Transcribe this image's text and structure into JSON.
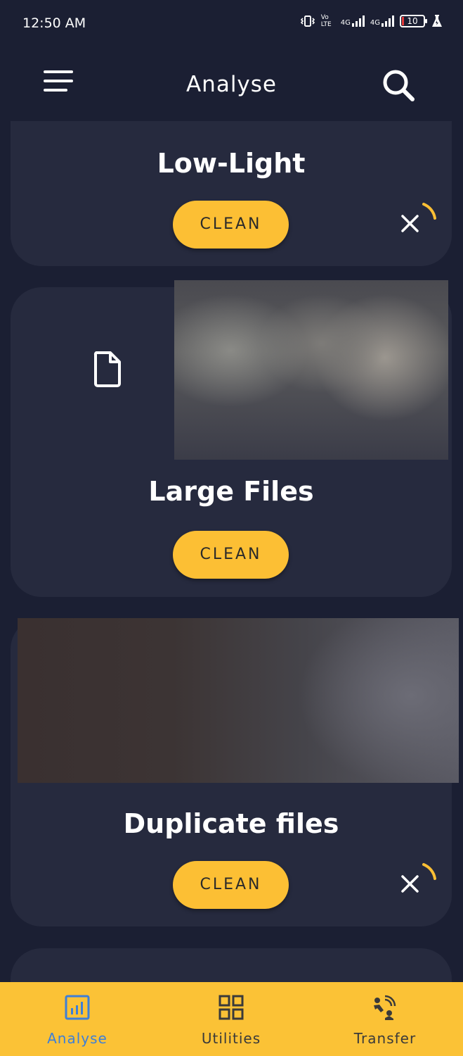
{
  "status_bar": {
    "time": "12:50 AM",
    "volte": "Vo LTE",
    "net1": "4G",
    "net2": "4G",
    "battery": "10",
    "icons": [
      "vibrate-icon",
      "volte-icon",
      "signal-icon",
      "signal-icon",
      "battery-icon",
      "battery-saver-icon"
    ]
  },
  "app_bar": {
    "title": "Analyse",
    "menu_icon": "hamburger-menu-icon",
    "search_icon": "search-icon"
  },
  "cards": [
    {
      "title": "Low-Light",
      "button": "CLEAN"
    },
    {
      "title": "Large Files",
      "button": "CLEAN",
      "icon": "file-icon"
    },
    {
      "title": "Duplicate files",
      "button": "CLEAN"
    }
  ],
  "bottom_nav": {
    "items": [
      {
        "label": "Analyse",
        "icon": "bar-chart-icon",
        "active": true
      },
      {
        "label": "Utilities",
        "icon": "grid-icon",
        "active": false
      },
      {
        "label": "Transfer",
        "icon": "transfer-icon",
        "active": false
      }
    ]
  },
  "colors": {
    "background": "#1b1f33",
    "card": "#262a3e",
    "accent": "#fcbf34",
    "nav_active": "#3d7fd8",
    "nav_inactive": "#3a3a3a"
  }
}
